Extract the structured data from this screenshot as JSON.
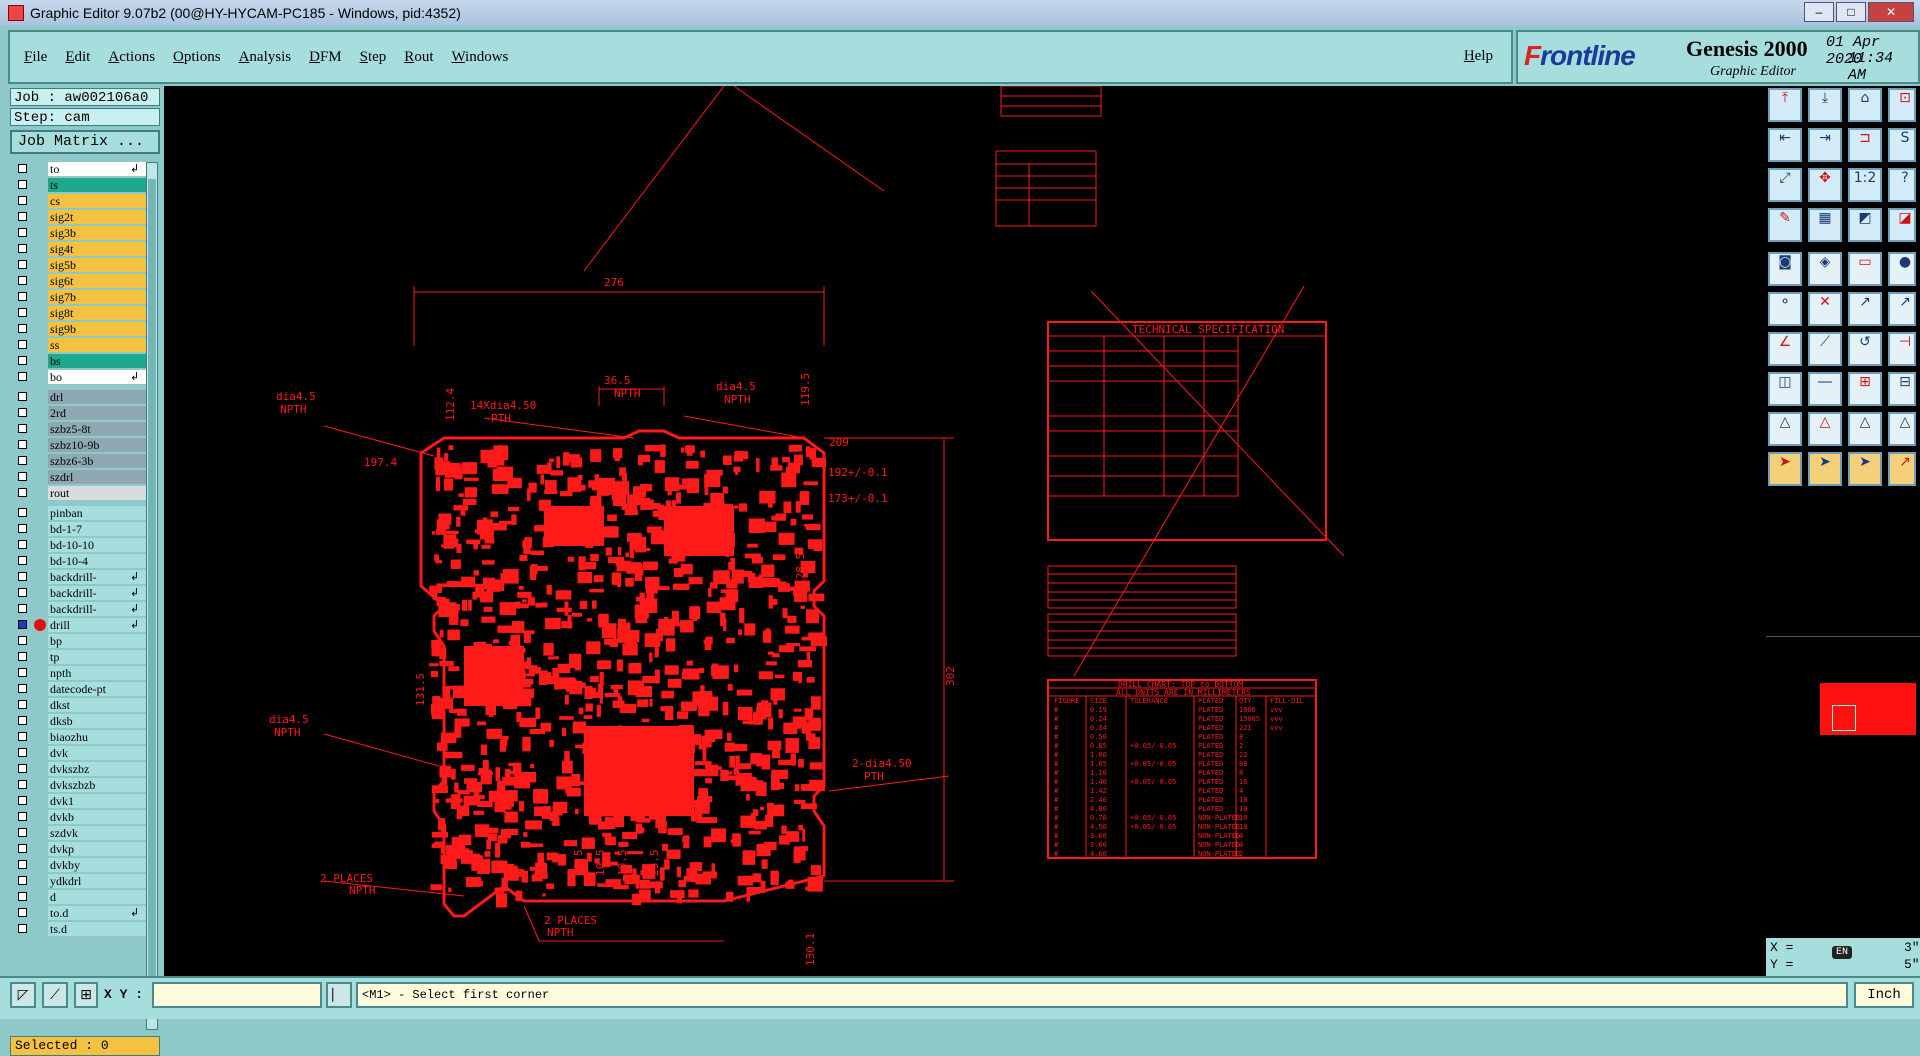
{
  "window": {
    "title": "Graphic Editor 9.07b2 (00@HY-HYCAM-PC185 - Windows, pid:4352)"
  },
  "menu": {
    "items": [
      "File",
      "Edit",
      "Actions",
      "Options",
      "Analysis",
      "DFM",
      "Step",
      "Rout",
      "Windows"
    ],
    "help": "Help"
  },
  "brand": {
    "logo": "Frontline",
    "product": "Genesis 2000",
    "subtitle": "Graphic Editor",
    "date": "01 Apr 2020",
    "time": "11:34 AM"
  },
  "job": {
    "job_label": "Job : aw002106a0",
    "step_label": "Step: cam",
    "matrix_button": "Job Matrix ..."
  },
  "layers": [
    {
      "name": "to",
      "color": "#ffffff",
      "mark": "↲"
    },
    {
      "name": "ts",
      "color": "#1fa88c",
      "mark": ""
    },
    {
      "name": "cs",
      "color": "#f5c140",
      "mark": ""
    },
    {
      "name": "sig2t",
      "color": "#f5c140",
      "mark": ""
    },
    {
      "name": "sig3b",
      "color": "#f5c140",
      "mark": ""
    },
    {
      "name": "sig4t",
      "color": "#f5c140",
      "mark": ""
    },
    {
      "name": "sig5b",
      "color": "#f5c140",
      "mark": ""
    },
    {
      "name": "sig6t",
      "color": "#f5c140",
      "mark": ""
    },
    {
      "name": "sig7b",
      "color": "#f5c140",
      "mark": ""
    },
    {
      "name": "sig8t",
      "color": "#f5c140",
      "mark": ""
    },
    {
      "name": "sig9b",
      "color": "#f5c140",
      "mark": ""
    },
    {
      "name": "ss",
      "color": "#f5c140",
      "mark": ""
    },
    {
      "name": "bs",
      "color": "#1fa88c",
      "mark": ""
    },
    {
      "name": "bo",
      "color": "#ffffff",
      "mark": "↲"
    },
    {
      "name": "drl",
      "color": "#8fa9b3",
      "mark": ""
    },
    {
      "name": "2rd",
      "color": "#8fa9b3",
      "mark": ""
    },
    {
      "name": "szbz5-8t",
      "color": "#8fa9b3",
      "mark": ""
    },
    {
      "name": "szbz10-9b",
      "color": "#8fa9b3",
      "mark": ""
    },
    {
      "name": "szbz6-3b",
      "color": "#8fa9b3",
      "mark": ""
    },
    {
      "name": "szdrl",
      "color": "#8fa9b3",
      "mark": ""
    },
    {
      "name": "rout",
      "color": "#d8dcdc",
      "mark": ""
    },
    {
      "name": "pinban",
      "color": "#a6dede",
      "mark": ""
    },
    {
      "name": "bd-1-7",
      "color": "#a6dede",
      "mark": ""
    },
    {
      "name": "bd-10-10",
      "color": "#a6dede",
      "mark": ""
    },
    {
      "name": "bd-10-4",
      "color": "#a6dede",
      "mark": ""
    },
    {
      "name": "backdrill-",
      "color": "#a6dede",
      "mark": "↲"
    },
    {
      "name": "backdrill-",
      "color": "#a6dede",
      "mark": "↲"
    },
    {
      "name": "backdrill-",
      "color": "#a6dede",
      "mark": "↲"
    },
    {
      "name": "drill",
      "color": "#a6dede",
      "mark": "↲",
      "active": true
    },
    {
      "name": "bp",
      "color": "#a6dede",
      "mark": ""
    },
    {
      "name": "tp",
      "color": "#a6dede",
      "mark": ""
    },
    {
      "name": "npth",
      "color": "#a6dede",
      "mark": ""
    },
    {
      "name": "datecode-pt",
      "color": "#a6dede",
      "mark": ""
    },
    {
      "name": "dkst",
      "color": "#a6dede",
      "mark": ""
    },
    {
      "name": "dksb",
      "color": "#a6dede",
      "mark": ""
    },
    {
      "name": "biaozhu",
      "color": "#a6dede",
      "mark": ""
    },
    {
      "name": "dvk",
      "color": "#a6dede",
      "mark": ""
    },
    {
      "name": "dvkszbz",
      "color": "#a6dede",
      "mark": ""
    },
    {
      "name": "dvkszbzb",
      "color": "#a6dede",
      "mark": ""
    },
    {
      "name": "dvk1",
      "color": "#a6dede",
      "mark": ""
    },
    {
      "name": "dvkb",
      "color": "#a6dede",
      "mark": ""
    },
    {
      "name": "szdvk",
      "color": "#a6dede",
      "mark": ""
    },
    {
      "name": "dvkp",
      "color": "#a6dede",
      "mark": ""
    },
    {
      "name": "dvkby",
      "color": "#a6dede",
      "mark": ""
    },
    {
      "name": "ydkdrl",
      "color": "#a6dede",
      "mark": ""
    },
    {
      "name": "d",
      "color": "#a6dede",
      "mark": ""
    },
    {
      "name": "to.d",
      "color": "#a6dede",
      "mark": "↲"
    },
    {
      "name": "ts.d",
      "color": "#a6dede",
      "mark": ""
    }
  ],
  "selected": "Selected : 0",
  "drawing": {
    "dims": {
      "top_width": "276",
      "slot": "36.5",
      "height_right": "302",
      "d1": "192+/-0.1",
      "d2": "173+/-0.1",
      "d3": "209",
      "d4": "197.4",
      "d5": "112.4",
      "d6": "119.5",
      "d7": "131.5",
      "d8": "128.5",
      "d9": "130.1"
    },
    "notes": {
      "npth_tl": "dia4.5",
      "npth_label": "NPTH",
      "pth_14": "14Xdia4.50",
      "pth_label": "PTH",
      "npth_tr": "dia4.5",
      "npth_l": "dia4.5",
      "pth_2": "2-dia4.50",
      "places_left": "2 PLACES",
      "places_bottom": "2 PLACES"
    },
    "bottom_dims": [
      "29.5",
      "10.5",
      "10.5",
      "29.5"
    ],
    "tech_spec_title": "TECHNICAL SPECIFICATION",
    "drill_chart": {
      "title": "DRILL CHART: TOP to BOTTOM",
      "subtitle": "ALL UNITS ARE IN MILLIMETERS",
      "headers": [
        "FIGURE",
        "SIZE",
        "TOLERANCE",
        "PLATED",
        "QTY",
        "FILL-OIL"
      ],
      "rows": [
        [
          "#",
          "0.19",
          "",
          "PLATED",
          "1606",
          "vvv"
        ],
        [
          "#",
          "0.24",
          "",
          "PLATED",
          "15085",
          "vvv"
        ],
        [
          "#",
          "0.34",
          "",
          "PLATED",
          "221",
          "vvv"
        ],
        [
          "#",
          "0.50",
          "",
          "PLATED",
          "8",
          ""
        ],
        [
          "#",
          "0.85",
          "+0.05/-0.05",
          "PLATED",
          "2",
          ""
        ],
        [
          "#",
          "1.00",
          "",
          "PLATED",
          "22",
          ""
        ],
        [
          "#",
          "1.05",
          "+0.05/-0.05",
          "PLATED",
          "88",
          ""
        ],
        [
          "#",
          "1.10",
          "",
          "PLATED",
          "8",
          ""
        ],
        [
          "#",
          "1.40",
          "+0.05/-0.05",
          "PLATED",
          "16",
          ""
        ],
        [
          "#",
          "1.42",
          "",
          "PLATED",
          "4",
          ""
        ],
        [
          "#",
          "2.40",
          "",
          "PLATED",
          "18",
          ""
        ],
        [
          "#",
          "4.00",
          "",
          "PLATED",
          "18",
          ""
        ],
        [
          "#",
          "0.70",
          "+0.05/-0.05",
          "NON-PLATED",
          "10",
          ""
        ],
        [
          "#",
          "4.50",
          "+0.05/-0.05",
          "NON-PLATED",
          "10",
          ""
        ],
        [
          "#",
          "3.60",
          "",
          "NON-PLATED",
          "4",
          ""
        ],
        [
          "#",
          "3.60",
          "",
          "NON-PLATED",
          "4",
          ""
        ],
        [
          "#",
          "4.60",
          "",
          "NON-PLATED",
          "2",
          ""
        ]
      ]
    }
  },
  "coords": {
    "x_label": "X =",
    "x_val": "3\"",
    "y_label": "Y =",
    "y_val": "5\"",
    "lang": "EN"
  },
  "bottom": {
    "xy_label": "X Y :",
    "xy_value": "",
    "status": "<M1> - Select first corner",
    "units": "Inch"
  },
  "colors": {
    "drawing": "#ff1a1a",
    "canvas": "#000000",
    "panel": "#a6dede"
  }
}
